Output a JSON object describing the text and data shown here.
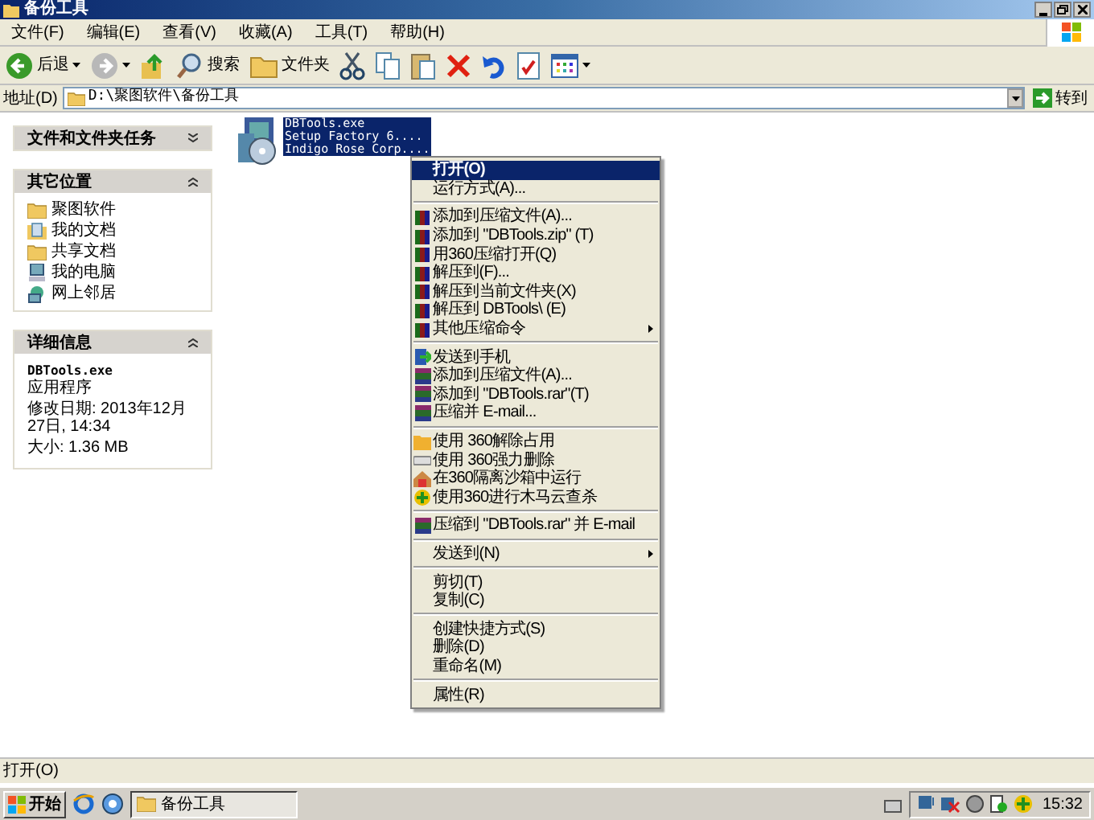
{
  "window": {
    "title": "备份工具"
  },
  "menu_bar": [
    "文件(F)",
    "编辑(E)",
    "查看(V)",
    "收藏(A)",
    "工具(T)",
    "帮助(H)"
  ],
  "toolbar": [
    {
      "kind": "back",
      "label": "后退",
      "dropdown": true
    },
    {
      "kind": "forward",
      "dropdown": true
    },
    {
      "kind": "up"
    },
    {
      "kind": "search",
      "label": "搜索"
    },
    {
      "kind": "folders",
      "label": "文件夹"
    },
    {
      "kind": "cut"
    },
    {
      "kind": "copy"
    },
    {
      "kind": "paste"
    },
    {
      "kind": "delete"
    },
    {
      "kind": "undo"
    },
    {
      "kind": "properties"
    },
    {
      "kind": "views",
      "dropdown": true
    }
  ],
  "address": {
    "label": "地址(D)",
    "value": "D:\\聚图软件\\备份工具",
    "go": "转到"
  },
  "sidebar": [
    {
      "kind": "tasks",
      "title": "文件和文件夹任务",
      "expanded": false
    },
    {
      "kind": "places",
      "title": "其它位置",
      "expanded": true,
      "items": [
        {
          "label": "聚图软件",
          "kind": "folder"
        },
        {
          "label": "我的文档",
          "kind": "documents"
        },
        {
          "label": "共享文档",
          "kind": "folder"
        },
        {
          "label": "我的电脑",
          "kind": "computer"
        },
        {
          "label": "网上邻居",
          "kind": "network"
        }
      ]
    },
    {
      "kind": "details",
      "title": "详细信息",
      "expanded": true,
      "name": "DBTools.exe",
      "lines": [
        "应用程序",
        "修改日期: 2013年12月27日, 14:34",
        "大小: 1.36 MB"
      ]
    }
  ],
  "file": {
    "selected": true,
    "lines": [
      "DBTools.exe",
      "Setup Factory 6....",
      "Indigo Rose Corp...."
    ]
  },
  "context_menu": [
    [
      {
        "label": "打开(O)",
        "kind": "plain",
        "selected": true,
        "default": true,
        "submenu": false
      },
      {
        "label": "运行方式(A)...",
        "kind": "plain",
        "selected": false,
        "default": false,
        "submenu": false
      }
    ],
    [
      {
        "label": "添加到压缩文件(A)...",
        "kind": "zip",
        "selected": false,
        "default": false,
        "submenu": false
      },
      {
        "label": "添加到 \"DBTools.zip\" (T)",
        "kind": "zip",
        "selected": false,
        "default": false,
        "submenu": false
      },
      {
        "label": "用360压缩打开(Q)",
        "kind": "zip",
        "selected": false,
        "default": false,
        "submenu": false
      },
      {
        "label": "解压到(F)...",
        "kind": "zip",
        "selected": false,
        "default": false,
        "submenu": false
      },
      {
        "label": "解压到当前文件夹(X)",
        "kind": "zip",
        "selected": false,
        "default": false,
        "submenu": false
      },
      {
        "label": "解压到 DBTools\\ (E)",
        "kind": "zip",
        "selected": false,
        "default": false,
        "submenu": false
      },
      {
        "label": "其他压缩命令",
        "kind": "zip",
        "selected": false,
        "default": false,
        "submenu": true
      }
    ],
    [
      {
        "label": "发送到手机",
        "kind": "phone",
        "selected": false,
        "default": false,
        "submenu": false
      },
      {
        "label": "添加到压缩文件(A)...",
        "kind": "rar",
        "selected": false,
        "default": false,
        "submenu": false
      },
      {
        "label": "添加到 \"DBTools.rar\"(T)",
        "kind": "rar",
        "selected": false,
        "default": false,
        "submenu": false
      },
      {
        "label": "压缩并 E-mail...",
        "kind": "rar",
        "selected": false,
        "default": false,
        "submenu": false
      }
    ],
    [
      {
        "label": "使用 360解除占用",
        "kind": "unlock",
        "selected": false,
        "default": false,
        "submenu": false
      },
      {
        "label": "使用 360强力删除",
        "kind": "shred",
        "selected": false,
        "default": false,
        "submenu": false
      },
      {
        "label": "在360隔离沙箱中运行",
        "kind": "sandbox",
        "selected": false,
        "default": false,
        "submenu": false
      },
      {
        "label": "使用360进行木马云查杀",
        "kind": "shield",
        "selected": false,
        "default": false,
        "submenu": false
      }
    ],
    [
      {
        "label": "压缩到 \"DBTools.rar\" 并 E-mail",
        "kind": "rar",
        "selected": false,
        "default": false,
        "submenu": false
      }
    ],
    [
      {
        "label": "发送到(N)",
        "kind": "plain",
        "selected": false,
        "default": false,
        "submenu": true
      }
    ],
    [
      {
        "label": "剪切(T)",
        "kind": "plain",
        "selected": false,
        "default": false,
        "submenu": false
      },
      {
        "label": "复制(C)",
        "kind": "plain",
        "selected": false,
        "default": false,
        "submenu": false
      }
    ],
    [
      {
        "label": "创建快捷方式(S)",
        "kind": "plain",
        "selected": false,
        "default": false,
        "submenu": false
      },
      {
        "label": "删除(D)",
        "kind": "plain",
        "selected": false,
        "default": false,
        "submenu": false
      },
      {
        "label": "重命名(M)",
        "kind": "plain",
        "selected": false,
        "default": false,
        "submenu": false
      }
    ],
    [
      {
        "label": "属性(R)",
        "kind": "plain",
        "selected": false,
        "default": false,
        "submenu": false
      }
    ]
  ],
  "status_bar": "打开(O)",
  "taskbar": {
    "start": "开始",
    "window": "备份工具",
    "clock": "15:32"
  }
}
